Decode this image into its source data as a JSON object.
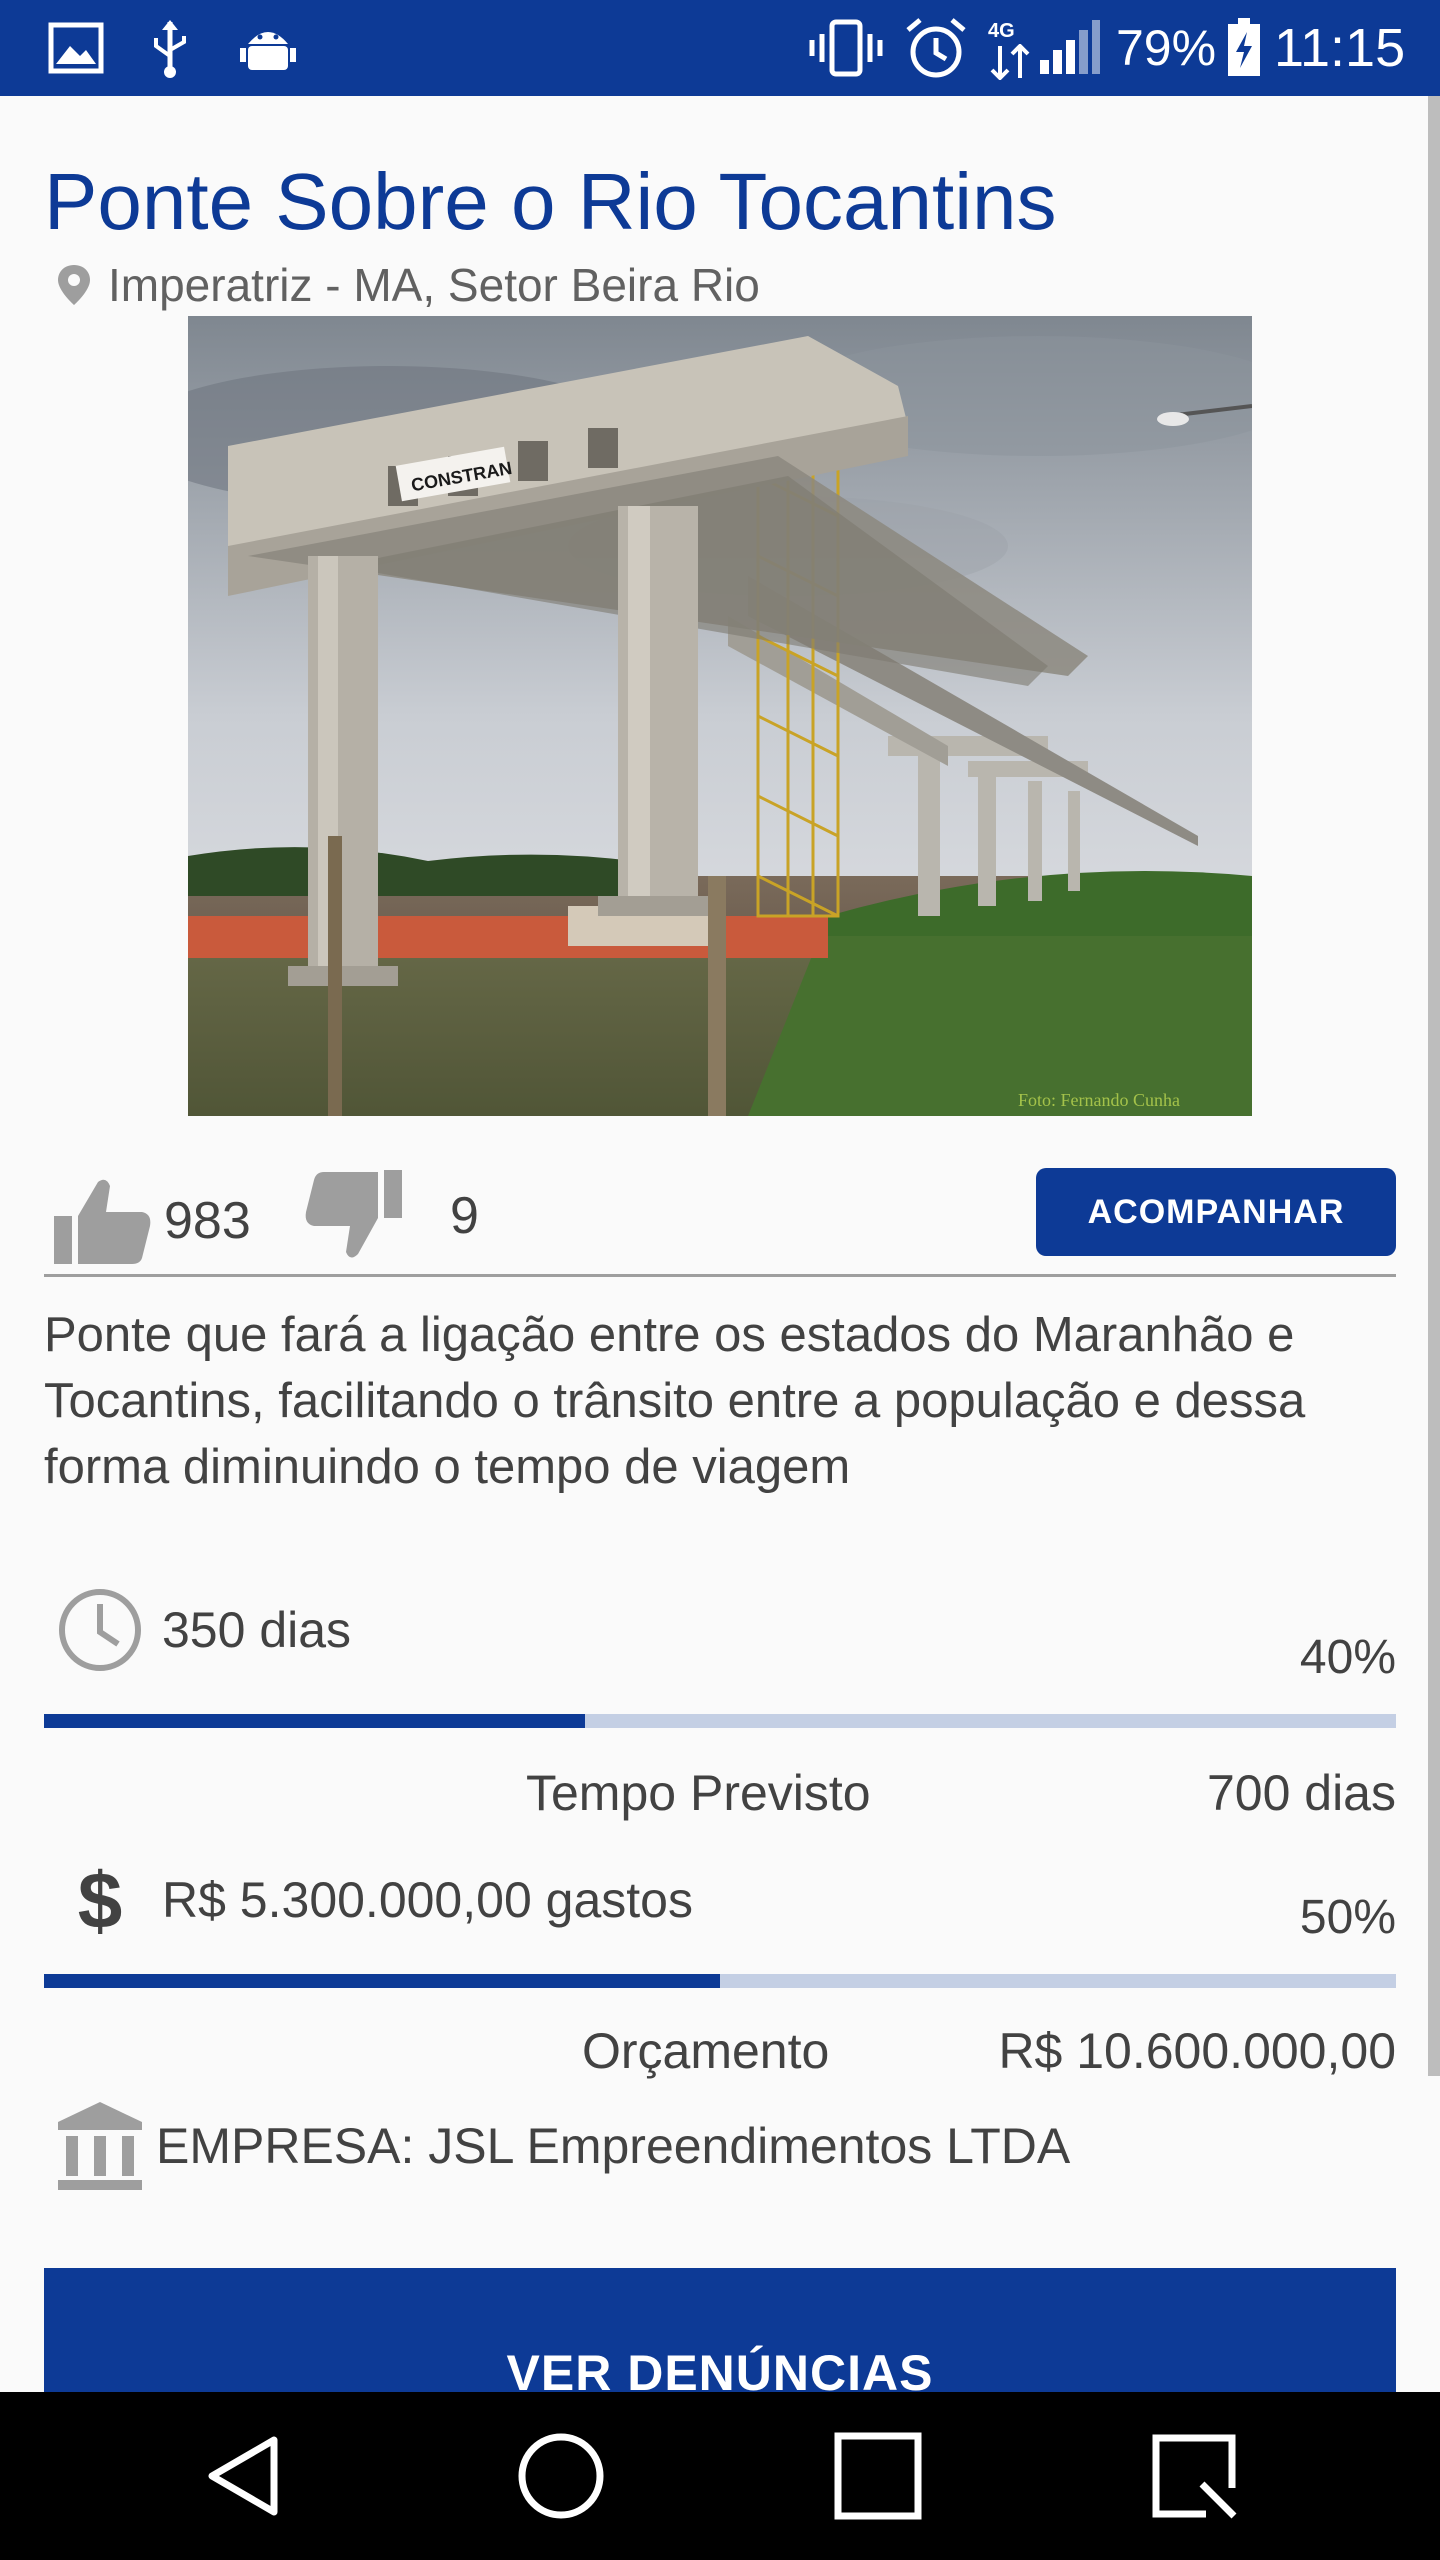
{
  "status_bar": {
    "network": "4G",
    "battery": "79%",
    "time": "11:15",
    "icons": [
      "image-icon",
      "usb-icon",
      "android-debug-icon",
      "vibrate-icon",
      "alarm-icon",
      "data-arrows-icon",
      "signal-icon",
      "battery-charging-icon"
    ]
  },
  "project": {
    "title": "Ponte Sobre o Rio Tocantins",
    "location": "Imperatriz - MA, Setor Beira Rio",
    "photo_sign": "CONSTRAN",
    "photo_credit": "Foto: Fernando Cunha"
  },
  "votes": {
    "likes": "983",
    "dislikes": "9",
    "follow_label": "ACOMPANHAR"
  },
  "description": "Ponte que fará a ligação entre os estados do Maranhão e Tocantins, facilitando o trânsito entre a população e dessa forma diminuindo o tempo de viagem",
  "time": {
    "elapsed": "350 dias",
    "percent_label": "40%",
    "progress": 0.4,
    "planned_label": "Tempo Previsto",
    "planned_value": "700 dias"
  },
  "budget": {
    "spent": "R$ 5.300.000,00 gastos",
    "percent_label": "50%",
    "progress": 0.5,
    "budget_label": "Orçamento",
    "budget_value": "R$ 10.600.000,00"
  },
  "company": "EMPRESA: JSL Empreendimentos LTDA",
  "reports_button": "VER DENÚNCIAS",
  "colors": {
    "primary": "#0d3a96",
    "track": "#c4cfe4",
    "text": "#424242",
    "muted": "#9e9e9e"
  }
}
